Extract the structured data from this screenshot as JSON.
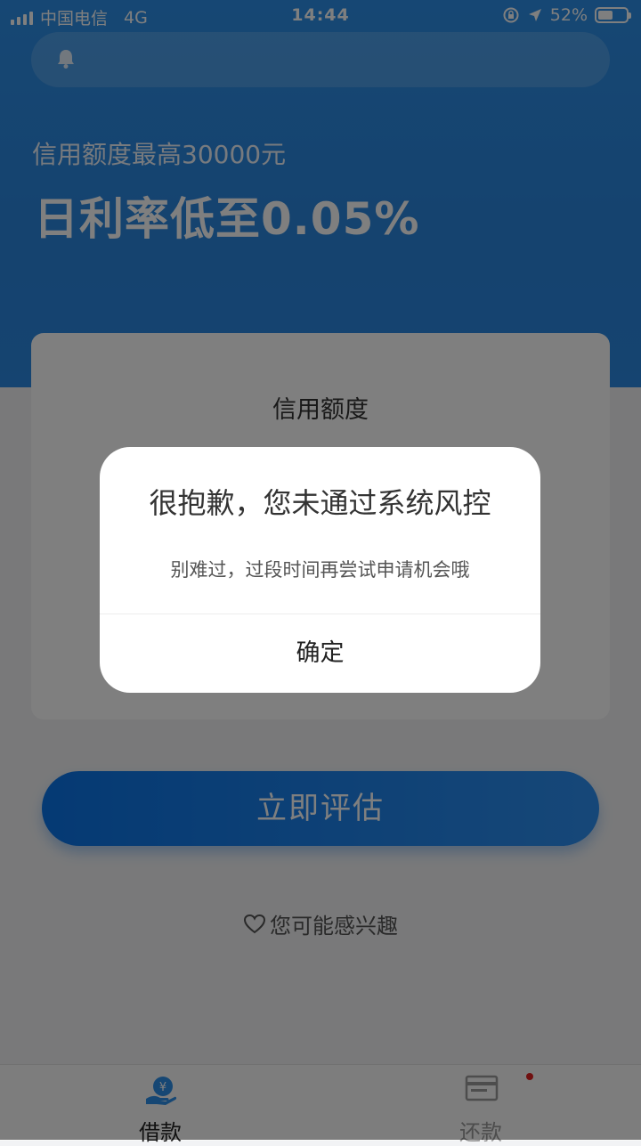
{
  "status_bar": {
    "carrier": "中国电信",
    "network": "4G",
    "time": "14:44",
    "battery": "52%",
    "battery_level": 0.52
  },
  "hero": {
    "subtitle": "信用额度最高30000元",
    "title": "日利率低至0.05%"
  },
  "card": {
    "label": "信用额度"
  },
  "primary_button": {
    "label": "立即评估"
  },
  "interest": {
    "label": "您可能感兴趣"
  },
  "dialog": {
    "title": "很抱歉，您未通过系统风控",
    "message": "别难过，过段时间再尝试申请机会哦",
    "confirm_label": "确定"
  },
  "tabbar": {
    "items": [
      {
        "label": "借款",
        "icon": "loan-hand-yen-icon",
        "active": true
      },
      {
        "label": "还款",
        "icon": "repay-card-icon",
        "active": false
      }
    ]
  },
  "colors": {
    "primary": "#2d8fe8",
    "badge": "#e02020"
  }
}
